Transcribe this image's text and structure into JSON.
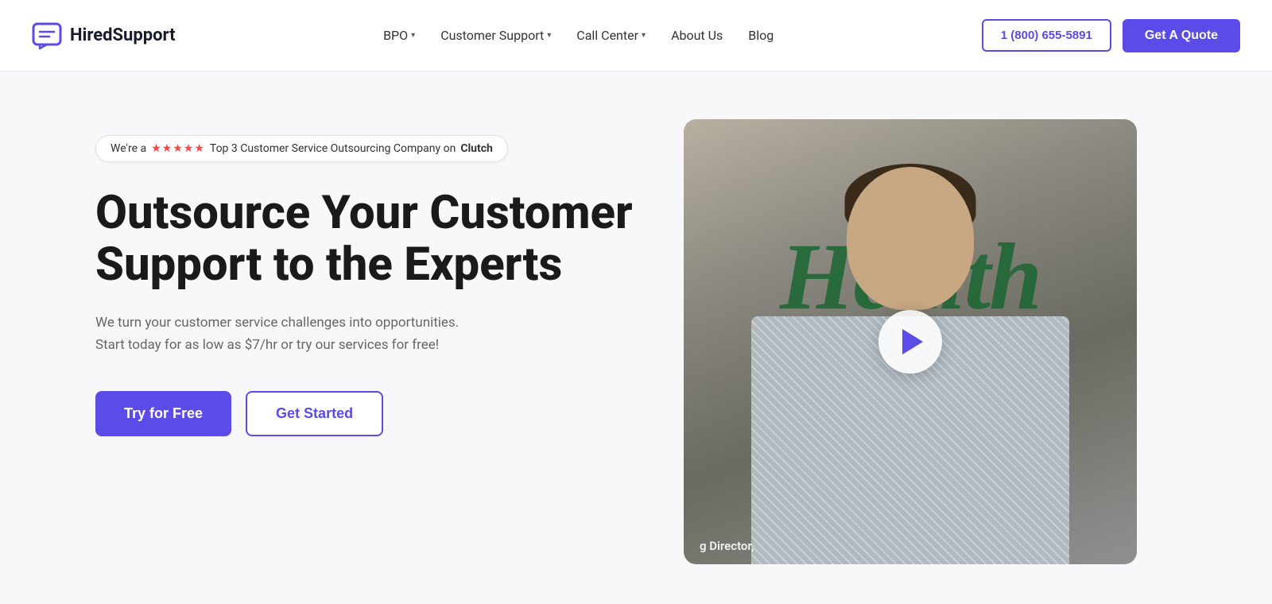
{
  "header": {
    "logo_text": "HiredSupport",
    "nav": [
      {
        "label": "BPO",
        "has_dropdown": true
      },
      {
        "label": "Customer Support",
        "has_dropdown": true
      },
      {
        "label": "Call Center",
        "has_dropdown": true
      },
      {
        "label": "About Us",
        "has_dropdown": false
      },
      {
        "label": "Blog",
        "has_dropdown": false
      }
    ],
    "phone": "1 (800) 655-5891",
    "quote_btn": "Get A Quote"
  },
  "hero": {
    "badge": {
      "prefix": "We're a",
      "stars": "★★★★★",
      "suffix_plain": "Top 3 Customer Service Outsourcing Company on",
      "suffix_bold": "Clutch"
    },
    "title": "Outsource Your Customer Support to the Experts",
    "subtitle": "We turn your customer service challenges into opportunities. Start today for as low as $7/hr or try our services for free!",
    "btn_primary": "Try for Free",
    "btn_secondary": "Get Started",
    "video_caption": "g Director,"
  }
}
